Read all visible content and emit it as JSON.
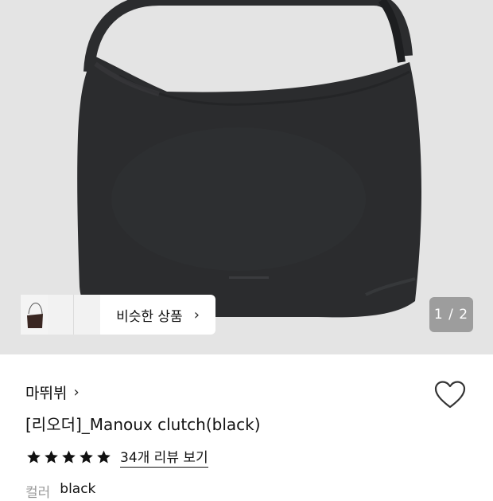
{
  "hero": {
    "similar_label": "비슷한 상품",
    "page_current": "1",
    "page_total": "2",
    "page_separator": " / "
  },
  "product": {
    "brand": "마뛰뷔",
    "title": "[리오더]_Manoux clutch(black)",
    "rating": 5,
    "review_link": "34개 리뷰 보기",
    "option_label": "컬러",
    "option_value": "black"
  },
  "colors": {
    "hero_bg": "#e4e4e4",
    "bag": "#2b2c2e",
    "counter_bg": "#9d9d9d"
  },
  "icons": [
    "heart-icon",
    "chevron-right-icon",
    "star-icon"
  ]
}
